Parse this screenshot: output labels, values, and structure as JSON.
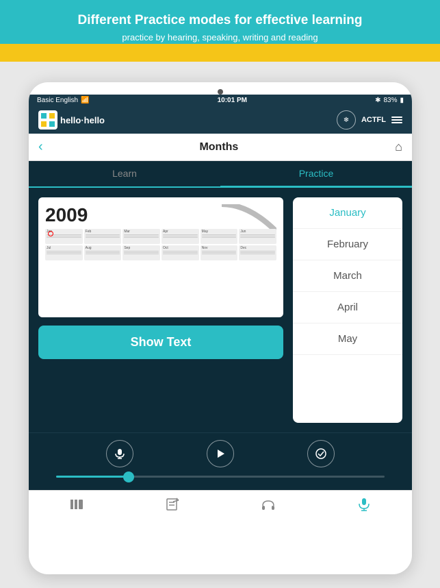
{
  "banner": {
    "title": "Different Practice modes for effective learning",
    "subtitle": "practice by hearing, speaking, writing and reading"
  },
  "status_bar": {
    "carrier": "Basic English",
    "time": "10:01 PM",
    "battery": "83%"
  },
  "app_header": {
    "logo": "hello·hello",
    "actfl": "ACTFL"
  },
  "nav": {
    "title": "Months",
    "back_label": "‹",
    "home_label": "⌂"
  },
  "tabs": {
    "learn": "Learn",
    "practice": "Practice"
  },
  "calendar": {
    "year": "2009"
  },
  "show_text_btn": "Show Text",
  "word_list": {
    "items": [
      {
        "label": "January",
        "state": "selected"
      },
      {
        "label": "February",
        "state": "normal"
      },
      {
        "label": "March",
        "state": "normal"
      },
      {
        "label": "April",
        "state": "normal"
      },
      {
        "label": "May",
        "state": "normal"
      }
    ]
  },
  "progress": {
    "value": 22
  },
  "bottom_nav": {
    "items": [
      {
        "icon": "📚",
        "label": "library",
        "active": false
      },
      {
        "icon": "✏️",
        "label": "write",
        "active": false
      },
      {
        "icon": "🎧",
        "label": "listen",
        "active": false
      },
      {
        "icon": "🎤",
        "label": "speak",
        "active": true
      }
    ]
  }
}
